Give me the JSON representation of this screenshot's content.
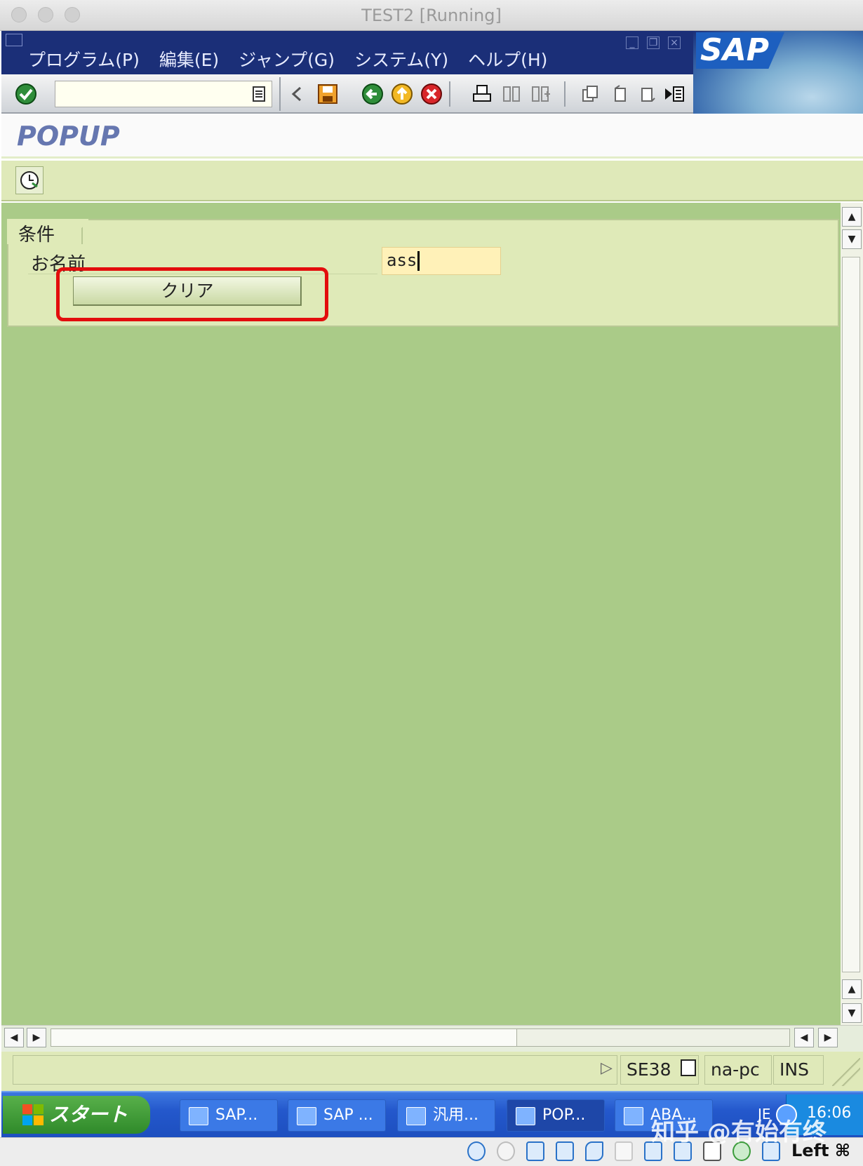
{
  "window": {
    "title": "TEST2 [Running]"
  },
  "menu": [
    "プログラム(P)",
    "編集(E)",
    "ジャンプ(G)",
    "システム(Y)",
    "ヘルプ(H)"
  ],
  "logo_text": "SAP",
  "toolbar": {
    "command_value": "",
    "icons": [
      "enter-icon",
      "back-nav-icon",
      "save-icon",
      "back-icon",
      "exit-icon",
      "cancel-icon",
      "print-icon",
      "find-icon",
      "find-next-icon",
      "first-page-icon",
      "previous-page-icon",
      "next-page-icon",
      "last-page-icon"
    ]
  },
  "page": {
    "title": "POPUP"
  },
  "app_toolbar": {
    "execute_icon": "clock-execute-icon"
  },
  "form": {
    "frame_title": "条件",
    "name_label": "お名前",
    "name_value": "ass",
    "clear_button": "クリア"
  },
  "status": {
    "transaction": "SE38",
    "system": "na-pc",
    "mode": "INS"
  },
  "taskbar": {
    "start_label": "スタート",
    "tasks": [
      {
        "label": "SAP..."
      },
      {
        "label": "SAP ..."
      },
      {
        "label": "汎用..."
      },
      {
        "label": "POP..."
      },
      {
        "label": "ABA..."
      }
    ],
    "lang": "JE",
    "clock": "16:06"
  },
  "vbox": {
    "host_key": "Left ⌘"
  },
  "watermark": "知乎 @有始有终",
  "colors": {
    "menu_bg": "#1b2f78",
    "screen_bg": "#aacb88",
    "frame_bg": "#dfeab8",
    "highlight": "#e30d0d"
  }
}
